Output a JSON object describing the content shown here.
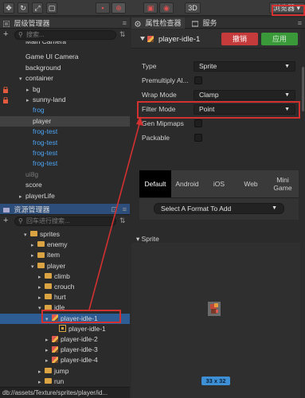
{
  "toolbar": {
    "buttons": [
      {
        "name": "move-tool-button",
        "glyph": "✥"
      },
      {
        "name": "rotate-tool-button",
        "glyph": "↻"
      },
      {
        "name": "scale-tool-button",
        "glyph": "⤢"
      },
      {
        "name": "rect-tool-button",
        "glyph": "▢"
      }
    ],
    "mode_3d": "3D",
    "browser_label": "浏览器",
    "browser_menu": "▾"
  },
  "hierarchy": {
    "title": "层级管理器",
    "search_placeholder": "搜索...",
    "rows": [
      {
        "label": "Main Camera",
        "color": "white",
        "indent": 0
      },
      {
        "label": "Game UI Camera",
        "color": "white",
        "indent": 0
      },
      {
        "label": "background",
        "color": "white",
        "indent": 0
      },
      {
        "label": "container",
        "color": "white",
        "indent": 0,
        "caret": "▾"
      },
      {
        "label": "bg",
        "color": "white",
        "indent": 1,
        "caret": "▸",
        "locked": true
      },
      {
        "label": "sunny-land",
        "color": "white",
        "indent": 1,
        "caret": "▸",
        "locked": true
      },
      {
        "label": "frog",
        "color": "blue",
        "indent": 1
      },
      {
        "label": "player",
        "color": "white",
        "indent": 1,
        "selected": true
      },
      {
        "label": "frog-test",
        "color": "blue",
        "indent": 1
      },
      {
        "label": "frog-test",
        "color": "blue",
        "indent": 1
      },
      {
        "label": "frog-test",
        "color": "blue",
        "indent": 1
      },
      {
        "label": "frog-test",
        "color": "blue",
        "indent": 1
      },
      {
        "label": "ui8g",
        "color": "dim",
        "indent": 0
      },
      {
        "label": "score",
        "color": "white",
        "indent": 0
      },
      {
        "label": "playerLife",
        "color": "white",
        "indent": 0,
        "caret": "▸"
      }
    ]
  },
  "assets": {
    "title": "资源管理器",
    "search_placeholder": "回车进行搜索...",
    "rows": [
      {
        "label": "sprites",
        "type": "folder",
        "indent": 0,
        "caret": "▾"
      },
      {
        "label": "enemy",
        "type": "folder",
        "indent": 1,
        "caret": "▸"
      },
      {
        "label": "item",
        "type": "folder",
        "indent": 1,
        "caret": "▸"
      },
      {
        "label": "player",
        "type": "folder",
        "indent": 1,
        "caret": "▾"
      },
      {
        "label": "climb",
        "type": "folder",
        "indent": 2,
        "caret": "▸"
      },
      {
        "label": "crouch",
        "type": "folder",
        "indent": 2,
        "caret": "▸"
      },
      {
        "label": "hurt",
        "type": "folder",
        "indent": 2,
        "caret": "▸"
      },
      {
        "label": "idle",
        "type": "folder",
        "indent": 2,
        "caret": "▾"
      },
      {
        "label": "player-idle-1",
        "type": "sprite",
        "indent": 3,
        "caret": "▾",
        "selected": true
      },
      {
        "label": "player-idle-1",
        "type": "atlas",
        "indent": 4
      },
      {
        "label": "player-idle-2",
        "type": "sprite",
        "indent": 3,
        "caret": "▸"
      },
      {
        "label": "player-idle-3",
        "type": "sprite",
        "indent": 3,
        "caret": "▸"
      },
      {
        "label": "player-idle-4",
        "type": "sprite",
        "indent": 3,
        "caret": "▸"
      },
      {
        "label": "jump",
        "type": "folder",
        "indent": 2,
        "caret": "▸"
      },
      {
        "label": "run",
        "type": "folder",
        "indent": 2,
        "caret": "▸"
      }
    ],
    "path": "db://assets/Texture/sprites/player/id..."
  },
  "inspector": {
    "tab_active": "属性检查器",
    "tab_other": "服务",
    "asset_name": "player-idle-1",
    "revert_label": "撤销",
    "apply_label": "应用",
    "props": {
      "type_label": "Type",
      "type_value": "Sprite",
      "premultiply_label": "Premultiply Al...",
      "wrap_label": "Wrap Mode",
      "wrap_value": "Clamp",
      "filter_label": "Filter Mode",
      "filter_value": "Point",
      "mipmaps_label": "Gen Mipmaps",
      "packable_label": "Packable"
    },
    "platforms": [
      "Default",
      "Android",
      "iOS",
      "Web",
      "Mini Game"
    ],
    "platform_active": "Default",
    "format_select": "Select A Format To Add",
    "sprite_section": "Sprite",
    "size_badge": "33 x 32"
  },
  "colors": {
    "accent_blue": "#3d8fd6",
    "revert_red": "#c53b3b",
    "apply_green": "#3a9a3a",
    "annotation_red": "#d33030",
    "folder_yellow": "#d9a441",
    "prefab_blue": "#4ba3f2"
  }
}
